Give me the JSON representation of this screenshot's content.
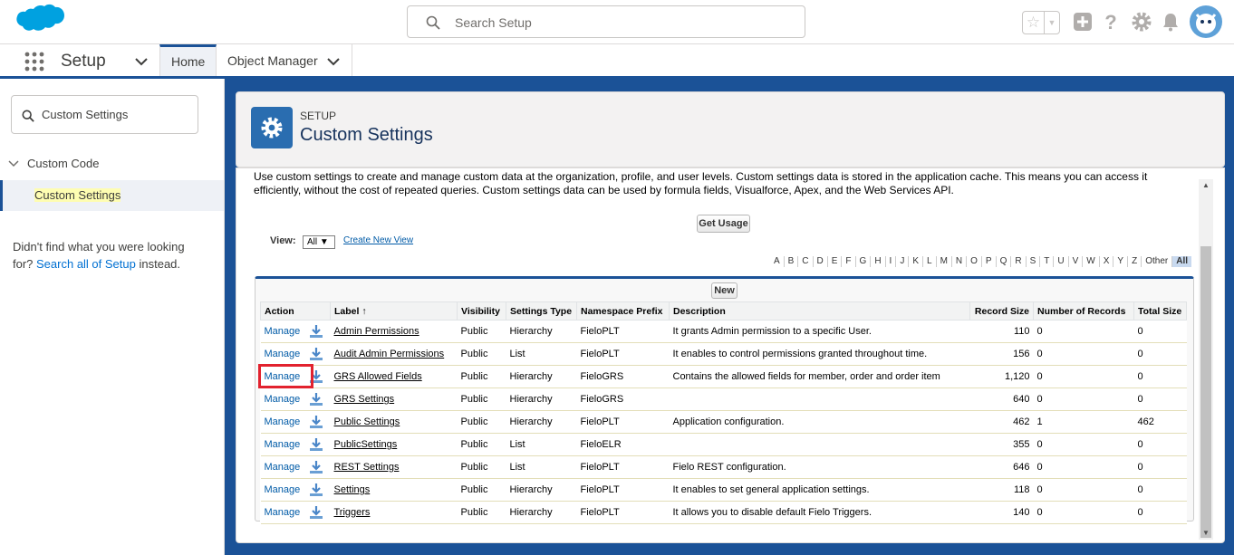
{
  "header": {
    "search_placeholder": "Search Setup",
    "icons": [
      "salesforce-cloud-logo",
      "search-icon",
      "star-icon",
      "add-icon",
      "help-icon",
      "gear-icon",
      "bell-icon",
      "avatar"
    ]
  },
  "app_nav": {
    "app_name": "Setup",
    "tabs": [
      {
        "label": "Home"
      },
      {
        "label": "Object Manager"
      }
    ]
  },
  "sidebar": {
    "quick_find_value": "Custom Settings",
    "tree_parent": "Custom Code",
    "tree_child": "Custom Settings",
    "help_prefix": "Didn't find what you were looking for? ",
    "help_link": "Search all of Setup",
    "help_suffix": " instead."
  },
  "page_header": {
    "eyebrow": "SETUP",
    "title": "Custom Settings"
  },
  "content": {
    "intro": "Use custom settings to create and manage custom data at the organization, profile, and user levels. Custom settings data is stored in the application cache. This means you can access it efficiently, without the cost of repeated queries. Custom settings data can be used by formula fields, Visualforce, Apex, and the Web Services API.",
    "get_usage_label": "Get Usage",
    "view_label": "View:",
    "view_value": "All ▼",
    "create_view_label": "Create New View",
    "alphabet": [
      "A",
      "B",
      "C",
      "D",
      "E",
      "F",
      "G",
      "H",
      "I",
      "J",
      "K",
      "L",
      "M",
      "N",
      "O",
      "P",
      "Q",
      "R",
      "S",
      "T",
      "U",
      "V",
      "W",
      "X",
      "Y",
      "Z",
      "Other",
      "All"
    ],
    "new_label": "New",
    "columns": [
      "Action",
      "Label ↑",
      "Visibility",
      "Settings Type",
      "Namespace Prefix",
      "Description",
      "Record Size",
      "Number of Records",
      "Total Size"
    ],
    "rows": [
      {
        "action": "Manage",
        "label": "Admin Permissions",
        "visibility": "Public",
        "type": "Hierarchy",
        "ns": "FieloPLT",
        "desc": "It grants Admin permission to a specific User.",
        "record_size": "110",
        "num_records": "0",
        "total_size": "0"
      },
      {
        "action": "Manage",
        "label": "Audit Admin Permissions",
        "visibility": "Public",
        "type": "List",
        "ns": "FieloPLT",
        "desc": "It enables to control permissions granted throughout time.",
        "record_size": "156",
        "num_records": "0",
        "total_size": "0"
      },
      {
        "action": "Manage",
        "label": "GRS Allowed Fields",
        "visibility": "Public",
        "type": "Hierarchy",
        "ns": "FieloGRS",
        "desc": "Contains the allowed fields for member, order and order item",
        "record_size": "1,120",
        "num_records": "0",
        "total_size": "0"
      },
      {
        "action": "Manage",
        "label": "GRS Settings",
        "visibility": "Public",
        "type": "Hierarchy",
        "ns": "FieloGRS",
        "desc": "",
        "record_size": "640",
        "num_records": "0",
        "total_size": "0"
      },
      {
        "action": "Manage",
        "label": "Public Settings",
        "visibility": "Public",
        "type": "Hierarchy",
        "ns": "FieloPLT",
        "desc": "Application configuration.",
        "record_size": "462",
        "num_records": "1",
        "total_size": "462"
      },
      {
        "action": "Manage",
        "label": "PublicSettings",
        "visibility": "Public",
        "type": "List",
        "ns": "FieloELR",
        "desc": "",
        "record_size": "355",
        "num_records": "0",
        "total_size": "0"
      },
      {
        "action": "Manage",
        "label": "REST Settings",
        "visibility": "Public",
        "type": "List",
        "ns": "FieloPLT",
        "desc": "Fielo REST configuration.",
        "record_size": "646",
        "num_records": "0",
        "total_size": "0"
      },
      {
        "action": "Manage",
        "label": "Settings",
        "visibility": "Public",
        "type": "Hierarchy",
        "ns": "FieloPLT",
        "desc": "It enables to set general application settings.",
        "record_size": "118",
        "num_records": "0",
        "total_size": "0"
      },
      {
        "action": "Manage",
        "label": "Triggers",
        "visibility": "Public",
        "type": "Hierarchy",
        "ns": "FieloPLT",
        "desc": "It allows you to disable default Fielo Triggers.",
        "record_size": "140",
        "num_records": "0",
        "total_size": "0"
      }
    ],
    "highlighted_row_index": 2
  },
  "colors": {
    "brand_blue": "#1b5297",
    "link_blue": "#0070d2",
    "highlight_red": "#e2222e",
    "setup_icon_bg": "#2a6db0"
  }
}
